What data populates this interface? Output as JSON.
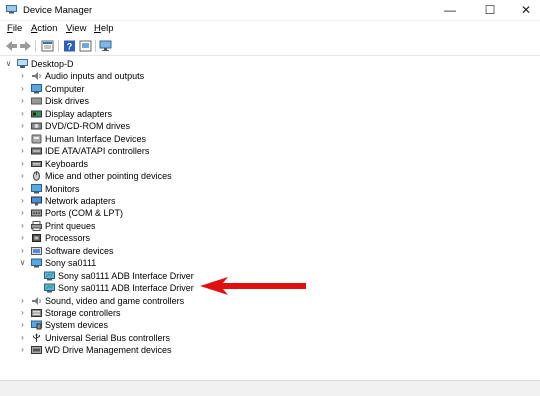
{
  "window": {
    "title": "Device Manager",
    "minimize": "—",
    "maximize": "☐",
    "close": "✕"
  },
  "menu": [
    {
      "label": "File",
      "key": "F",
      "rest": "ile"
    },
    {
      "label": "Action",
      "key": "A",
      "rest": "ction"
    },
    {
      "label": "View",
      "key": "V",
      "rest": "iew"
    },
    {
      "label": "Help",
      "key": "H",
      "rest": "elp"
    }
  ],
  "tree": {
    "root": "Desktop-D",
    "categories": [
      {
        "label": "Audio inputs and outputs",
        "icon": "speaker-icon"
      },
      {
        "label": "Computer",
        "icon": "monitor-icon"
      },
      {
        "label": "Disk drives",
        "icon": "disk-icon"
      },
      {
        "label": "Display adapters",
        "icon": "display-adapter-icon"
      },
      {
        "label": "DVD/CD-ROM drives",
        "icon": "dvd-icon"
      },
      {
        "label": "Human Interface Devices",
        "icon": "hid-icon"
      },
      {
        "label": "IDE ATA/ATAPI controllers",
        "icon": "ide-icon"
      },
      {
        "label": "Keyboards",
        "icon": "keyboard-icon"
      },
      {
        "label": "Mice and other pointing devices",
        "icon": "mouse-icon"
      },
      {
        "label": "Monitors",
        "icon": "monitor-icon"
      },
      {
        "label": "Network adapters",
        "icon": "network-icon"
      },
      {
        "label": "Ports (COM & LPT)",
        "icon": "port-icon"
      },
      {
        "label": "Print queues",
        "icon": "printer-icon"
      },
      {
        "label": "Processors",
        "icon": "processor-icon"
      },
      {
        "label": "Software devices",
        "icon": "software-icon"
      },
      {
        "label": "Sony sa0111",
        "icon": "device-icon",
        "expanded": true,
        "children": [
          {
            "label": "Sony sa0111 ADB Interface Driver"
          },
          {
            "label": "Sony sa0111 ADB Interface Driver"
          }
        ]
      },
      {
        "label": "Sound, video and game controllers",
        "icon": "speaker-icon"
      },
      {
        "label": "Storage controllers",
        "icon": "storage-icon"
      },
      {
        "label": "System devices",
        "icon": "system-icon"
      },
      {
        "label": "Universal Serial Bus controllers",
        "icon": "usb-icon"
      },
      {
        "label": "WD Drive Management devices",
        "icon": "wd-icon"
      }
    ]
  },
  "colors": {
    "arrow": "#e01010"
  }
}
